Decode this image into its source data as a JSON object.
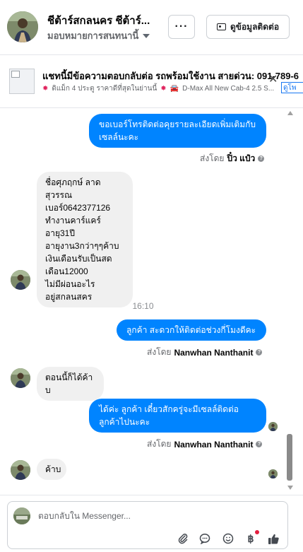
{
  "header": {
    "contact_name": "ชีต้าร์สกลนคร ชีต้าร์...",
    "assignee": "มอบหมายการสนทนานี้",
    "more_label": "···",
    "contact_button": "ดูข้อมูลติดต่อ"
  },
  "ad": {
    "title": "แชทนี้มีข้อความตอบกลับต่อ รถพร้อมใช้งาน สายด่วน: 091-789-6",
    "subtitle_1": "ดิแม็ก 4 ประตู ราคาดีที่สุดในย่านนี้",
    "subtitle_2": "D-Max All New Cab-4 2.5 S...",
    "link": "ดูโพ",
    "close": "✕"
  },
  "messages": [
    {
      "dir": "out",
      "text": "ขอเบอร์โทรติดต่อคุยรายละเอียดเพิ่มเติมกับเซลล์นะคะ"
    },
    {
      "dir": "out_meta",
      "prefix": "ส่งโดย",
      "sender": "ปิ๋ว แป๋ว"
    },
    {
      "dir": "in",
      "text": "ชื่อศุภฤกษ์ ลาดสุวรรณ\nเบอร์0642377126\nทำงานคาร์แคร์\nอายุ31ปี\nอายุงาน3กว่าๆๆค้าบ\nเงินเดือนรับเป็นสด\nเดือน12000\nไม่มีผ่อนอะไร\nอยู่สกลนสคร"
    },
    {
      "dir": "time",
      "text": "16:10"
    },
    {
      "dir": "out",
      "text": "ลูกค้า สะดวกให้ติดต่อช่วงกี่โมงดีคะ"
    },
    {
      "dir": "out_meta",
      "prefix": "ส่งโดย",
      "sender": "Nanwhan Nanthanit"
    },
    {
      "dir": "in",
      "text": "ตอนนี้ก็ได้ค้าบ"
    },
    {
      "dir": "out",
      "text": "ได้ค่ะ  ลูกค้า เดี๋ยวสักครู่จะมีเซลล์ติดต่อ ลูกค้าไปนะคะ"
    },
    {
      "dir": "out_meta",
      "prefix": "ส่งโดย",
      "sender": "Nanwhan Nanthanit"
    },
    {
      "dir": "in",
      "text": "ค้าบ"
    }
  ],
  "composer": {
    "placeholder": "ตอบกลับใน Messenger..."
  },
  "colors": {
    "outgoing_bubble": "#0084ff",
    "incoming_bubble": "#f0f0f0",
    "notification_dot": "#e41e3f"
  },
  "icons": [
    "attachment-icon",
    "chat-bubble-icon",
    "emoji-icon",
    "baht-icon",
    "thumbs-up-icon"
  ]
}
